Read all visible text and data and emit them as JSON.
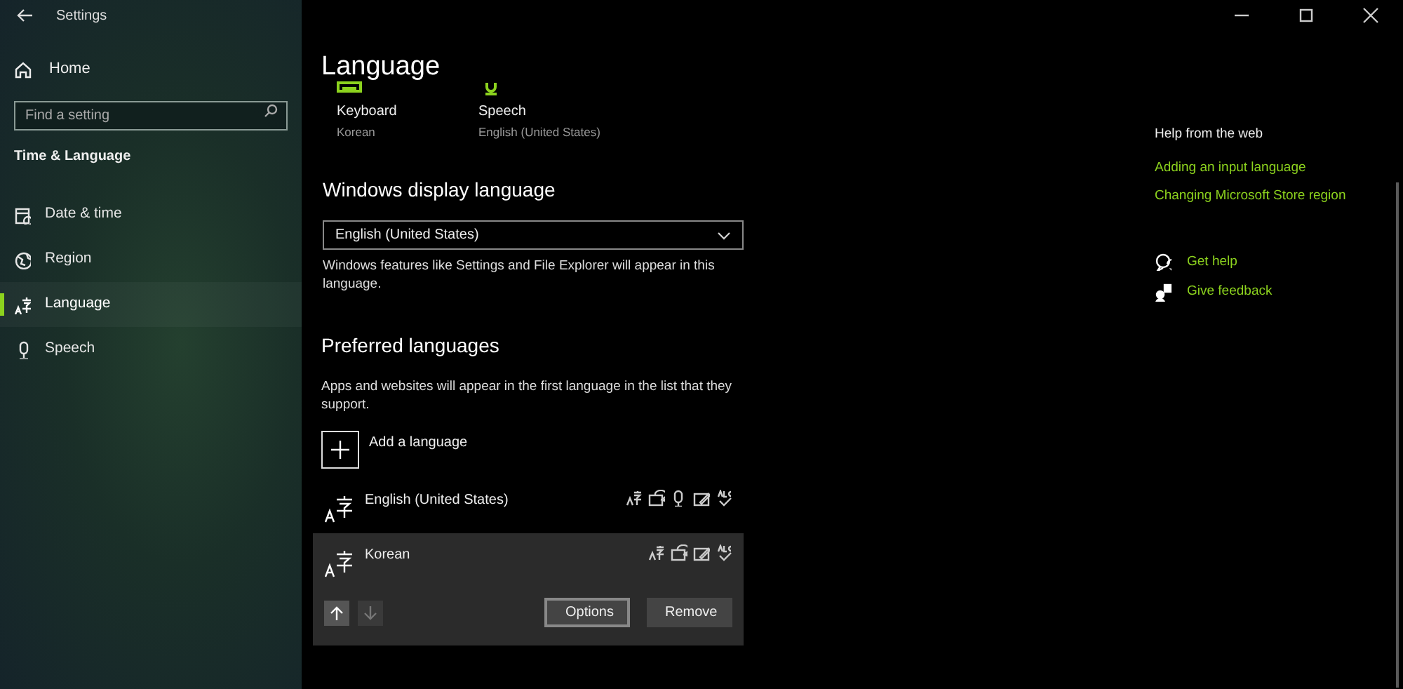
{
  "window": {
    "title": "Settings"
  },
  "sidebar": {
    "home": "Home",
    "search": {
      "placeholder": "Find a setting"
    },
    "section": "Time & Language",
    "items": [
      {
        "label": "Date & time",
        "kind": "clock",
        "selected": false
      },
      {
        "label": "Region",
        "kind": "globe",
        "selected": false
      },
      {
        "label": "Language",
        "kind": "language",
        "selected": true
      },
      {
        "label": "Speech",
        "kind": "mic",
        "selected": false
      }
    ]
  },
  "page": {
    "title": "Language",
    "tiles": [
      {
        "kind": "keyboard",
        "label": "Keyboard",
        "value": "Korean"
      },
      {
        "kind": "mic",
        "label": "Speech",
        "value": "English (United States)"
      }
    ],
    "display_language": {
      "heading": "Windows display language",
      "value": "English (United States)",
      "note": "Windows features like Settings and File Explorer will appear in this language."
    },
    "preferred": {
      "heading": "Preferred languages",
      "note": "Apps and websites will appear in the first language in the list that they support.",
      "add": "Add a language",
      "languages": [
        {
          "name": "English (United States)",
          "selected": false,
          "features": [
            {
              "kind": "display"
            },
            {
              "kind": "tts"
            },
            {
              "kind": "speech"
            },
            {
              "kind": "handwriting"
            },
            {
              "kind": "spelling"
            }
          ]
        },
        {
          "name": "Korean",
          "selected": true,
          "features": [
            {
              "kind": "display"
            },
            {
              "kind": "tts"
            },
            {
              "kind": "handwriting"
            },
            {
              "kind": "spelling"
            }
          ],
          "move_up_disabled": false,
          "move_down_disabled": true,
          "buttons": [
            "Options",
            "Remove"
          ]
        }
      ]
    }
  },
  "help": {
    "heading": "Help from the web",
    "links": [
      "Adding an input language",
      "Changing Microsoft Store region"
    ],
    "actions": [
      {
        "kind": "help",
        "label": "Get help"
      },
      {
        "kind": "feedback",
        "label": "Give feedback"
      }
    ]
  }
}
